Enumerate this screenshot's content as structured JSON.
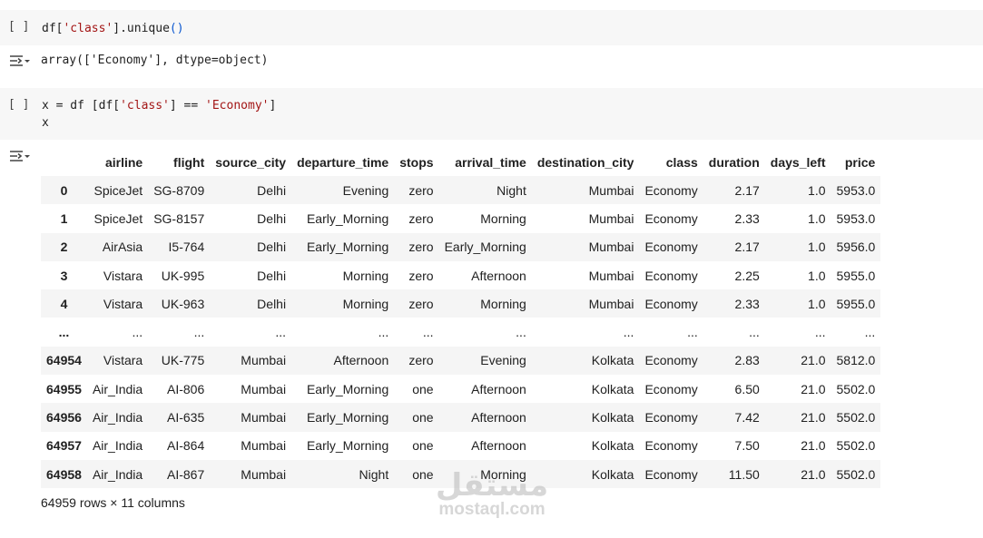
{
  "cell1": {
    "run_label": "[ ]",
    "code_prefix": "df[",
    "code_str": "'class'",
    "code_mid": "].unique",
    "code_paren": "()",
    "output": "array(['Economy'], dtype=object)"
  },
  "cell2": {
    "run_label": "[ ]",
    "line1_prefix": "x = df [df[",
    "line1_str1": "'class'",
    "line1_mid": "] == ",
    "line1_str2": "'Economy'",
    "line1_suffix": "]",
    "line2": "x"
  },
  "dataframe": {
    "columns": [
      "",
      "airline",
      "flight",
      "source_city",
      "departure_time",
      "stops",
      "arrival_time",
      "destination_city",
      "class",
      "duration",
      "days_left",
      "price"
    ],
    "rows": [
      [
        "0",
        "SpiceJet",
        "SG-8709",
        "Delhi",
        "Evening",
        "zero",
        "Night",
        "Mumbai",
        "Economy",
        "2.17",
        "1.0",
        "5953.0"
      ],
      [
        "1",
        "SpiceJet",
        "SG-8157",
        "Delhi",
        "Early_Morning",
        "zero",
        "Morning",
        "Mumbai",
        "Economy",
        "2.33",
        "1.0",
        "5953.0"
      ],
      [
        "2",
        "AirAsia",
        "I5-764",
        "Delhi",
        "Early_Morning",
        "zero",
        "Early_Morning",
        "Mumbai",
        "Economy",
        "2.17",
        "1.0",
        "5956.0"
      ],
      [
        "3",
        "Vistara",
        "UK-995",
        "Delhi",
        "Morning",
        "zero",
        "Afternoon",
        "Mumbai",
        "Economy",
        "2.25",
        "1.0",
        "5955.0"
      ],
      [
        "4",
        "Vistara",
        "UK-963",
        "Delhi",
        "Morning",
        "zero",
        "Morning",
        "Mumbai",
        "Economy",
        "2.33",
        "1.0",
        "5955.0"
      ],
      [
        "...",
        "...",
        "...",
        "...",
        "...",
        "...",
        "...",
        "...",
        "...",
        "...",
        "...",
        "..."
      ],
      [
        "64954",
        "Vistara",
        "UK-775",
        "Mumbai",
        "Afternoon",
        "zero",
        "Evening",
        "Kolkata",
        "Economy",
        "2.83",
        "21.0",
        "5812.0"
      ],
      [
        "64955",
        "Air_India",
        "AI-806",
        "Mumbai",
        "Early_Morning",
        "one",
        "Afternoon",
        "Kolkata",
        "Economy",
        "6.50",
        "21.0",
        "5502.0"
      ],
      [
        "64956",
        "Air_India",
        "AI-635",
        "Mumbai",
        "Early_Morning",
        "one",
        "Afternoon",
        "Kolkata",
        "Economy",
        "7.42",
        "21.0",
        "5502.0"
      ],
      [
        "64957",
        "Air_India",
        "AI-864",
        "Mumbai",
        "Early_Morning",
        "one",
        "Afternoon",
        "Kolkata",
        "Economy",
        "7.50",
        "21.0",
        "5502.0"
      ],
      [
        "64958",
        "Air_India",
        "AI-867",
        "Mumbai",
        "Night",
        "one",
        "Morning",
        "Kolkata",
        "Economy",
        "11.50",
        "21.0",
        "5502.0"
      ]
    ],
    "shape_info": "64959 rows × 11 columns"
  },
  "watermark": {
    "arabic": "مستقل",
    "latin": "mostaql.com"
  },
  "icons": {
    "run": "run-cell-icon",
    "output": "output-options-icon"
  }
}
